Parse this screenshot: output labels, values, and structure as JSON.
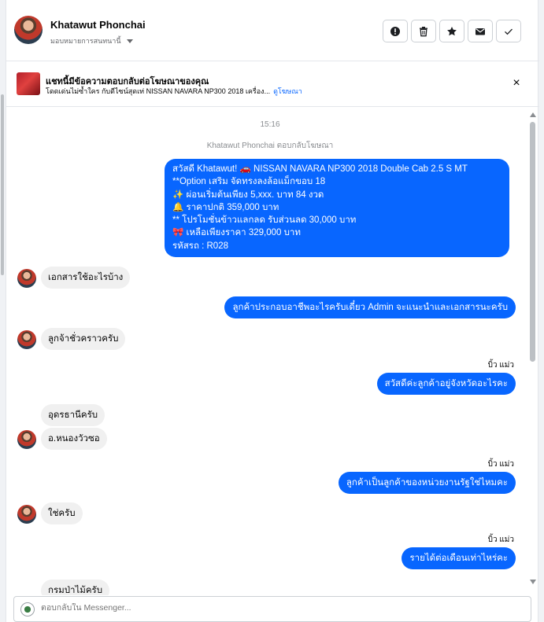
{
  "header": {
    "contact_name": "Khatawut Phonchai",
    "assign_label": "มอบหมายการสนทนานี้",
    "actions": [
      "alert-icon",
      "trash-icon",
      "star-icon",
      "mail-icon",
      "check-icon"
    ]
  },
  "ad_banner": {
    "title": "แชทนี้มีข้อความตอบกลับต่อโฆษณาของคุณ",
    "subtitle": "โดดเด่นไม่ซ้ำใคร กับดีไซน์สุดเท่ NISSAN NAVARA NP300 2018 เครื่อง...",
    "link": "ดูโฆษณา",
    "close_glyph": "×"
  },
  "conversation": {
    "timestamp": "15:16",
    "system_note": "Khatawut Phonchai ตอบกลับโฆษณา",
    "messages": [
      {
        "from": "page",
        "text": "สวัสดี Khatawut! 🚗 NISSAN NAVARA NP300 2018 Double Cab 2.5 S MT\n**Option เสริม จัดทรงลงล้อแม็กขอบ 18\n✨ ผ่อนเริ่มต้นเพียง 5,xxx. บาท 84 งวด\n🔔 ราคาปกติ 359,000 บาท\n** โปรโมชั่นข้าวแลกลด รับส่วนลด 30,000 บาท\n🎀 เหลือเพียงราคา 329,000 บาท\nรหัสรถ : R028"
      },
      {
        "from": "user",
        "text": "เอกสารใช้อะไรบ้าง"
      },
      {
        "from": "page",
        "text": "ลูกค้าประกอบอาชีพอะไรครับเดี๋ยว Admin จะแนะนำและเอกสารนะครับ"
      },
      {
        "from": "user",
        "text": "ลูกจ้าชั่วคราวครับ"
      },
      {
        "from": "page",
        "seen": "บิ้ว แม่ว",
        "text": "สวัสดีค่ะลูกค้าอยู่จังหวัดอะไรคะ"
      },
      {
        "from": "user",
        "text": "อุดรธานีครับ"
      },
      {
        "from": "user",
        "text": "อ.หนองวัวซอ"
      },
      {
        "from": "page",
        "seen": "บิ้ว แม่ว",
        "text": "ลูกค้าเป็นลูกค้าของหน่วยงานรัฐใช่ไหมคะ"
      },
      {
        "from": "user",
        "text": "ใช่ครับ"
      },
      {
        "from": "page",
        "seen": "บิ้ว แม่ว",
        "text": "รายได้ต่อเดือนเท่าไหร่คะ"
      },
      {
        "from": "user",
        "text": "กรมป่าไม้ครับ"
      }
    ]
  },
  "composer": {
    "placeholder": "ตอบกลับใน Messenger..."
  },
  "colors": {
    "outgoing_bubble": "#0866ff",
    "incoming_bubble": "#f0f0f0",
    "link": "#0866ff"
  }
}
